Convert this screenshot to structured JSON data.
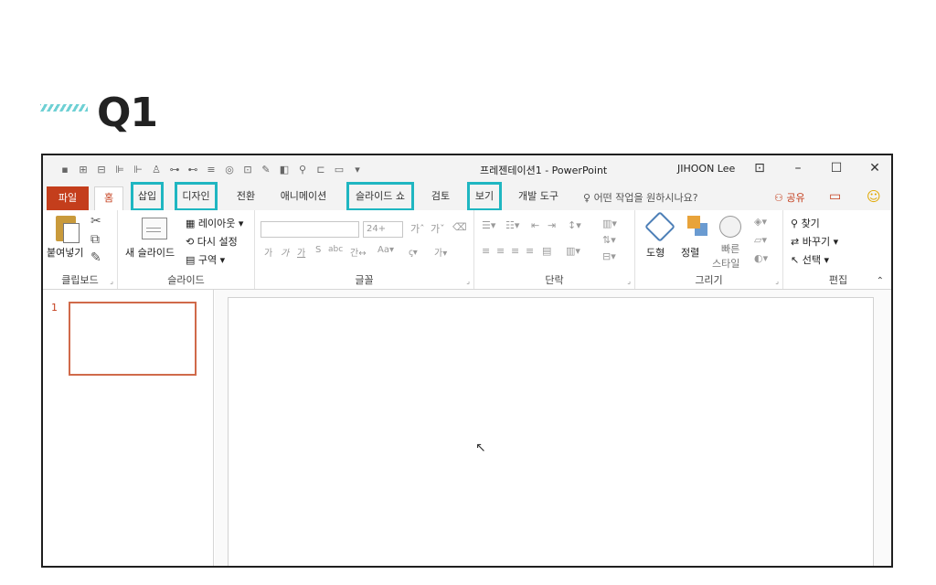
{
  "heading": {
    "label": "Q1"
  },
  "titlebar": {
    "document_title": "프레젠테이션1 - PowerPoint",
    "user_name": "JIHOON Lee",
    "qat_icons": [
      "save-icon",
      "chart-icon",
      "table-icon",
      "align-icon",
      "distribute-icon",
      "person-icon",
      "spacing-icon",
      "spacing2-icon",
      "lines-icon",
      "shape-icon",
      "format-icon",
      "brush-icon",
      "view-icon",
      "link-icon",
      "frame-icon",
      "layout-icon",
      "more-icon"
    ]
  },
  "tabs": {
    "file": "파일",
    "home": "홈",
    "insert": "삽입",
    "design": "디자인",
    "transitions": "전환",
    "animations": "애니메이션",
    "slideshow": "슬라이드 쇼",
    "review": "검토",
    "view": "보기",
    "developer": "개발 도구",
    "tell_me": "어떤 작업을 원하시나요?",
    "share": "공유"
  },
  "ribbon": {
    "clipboard": {
      "paste": "붙여넣기",
      "label": "클립보드"
    },
    "slides": {
      "new_slide": "새 슬라이드",
      "layout": "레이아웃",
      "reset": "다시 설정",
      "section": "구역",
      "label": "슬라이드"
    },
    "font": {
      "size": "24+",
      "label": "글꼴"
    },
    "paragraph": {
      "label": "단락"
    },
    "drawing": {
      "shapes": "도형",
      "arrange": "정렬",
      "quick_styles_1": "빠른",
      "quick_styles_2": "스타일",
      "label": "그리기"
    },
    "editing": {
      "find": "찾기",
      "replace": "바꾸기",
      "select": "선택",
      "label": "편집"
    }
  },
  "slides_panel": {
    "slide_number": "1"
  },
  "colors": {
    "accent": "#c43e1c",
    "highlight": "#1fb6c1"
  }
}
